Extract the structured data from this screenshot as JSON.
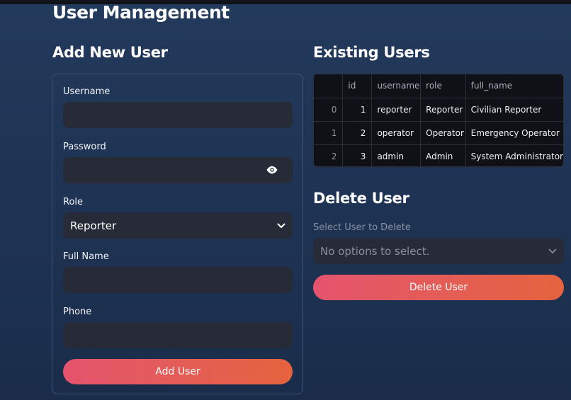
{
  "page": {
    "title": "User Management"
  },
  "add_form": {
    "title": "Add New User",
    "username_label": "Username",
    "username_value": "",
    "password_label": "Password",
    "password_value": "",
    "role_label": "Role",
    "role_value": "Reporter",
    "fullname_label": "Full Name",
    "fullname_value": "",
    "phone_label": "Phone",
    "phone_value": "",
    "submit_label": "Add User"
  },
  "existing": {
    "title": "Existing Users",
    "columns": [
      "",
      "id",
      "username",
      "role",
      "full_name"
    ],
    "rows": [
      {
        "index": "0",
        "id": "1",
        "username": "reporter",
        "role": "Reporter",
        "full_name": "Civilian Reporter"
      },
      {
        "index": "1",
        "id": "2",
        "username": "operator",
        "role": "Operator",
        "full_name": "Emergency Operator"
      },
      {
        "index": "2",
        "id": "3",
        "username": "admin",
        "role": "Admin",
        "full_name": "System Administrator"
      }
    ]
  },
  "delete": {
    "title": "Delete User",
    "select_label": "Select User to Delete",
    "select_placeholder": "No options to select.",
    "button_label": "Delete User"
  },
  "icons": {
    "password_toggle": "eye-icon",
    "role_dropdown": "chevron-down-icon",
    "delete_dropdown": "chevron-down-icon"
  },
  "colors": {
    "accent_start": "#e4546e",
    "accent_end": "#e5633e",
    "background": "#1f3556",
    "input_bg": "#262b37",
    "table_bg": "#0f1117"
  }
}
